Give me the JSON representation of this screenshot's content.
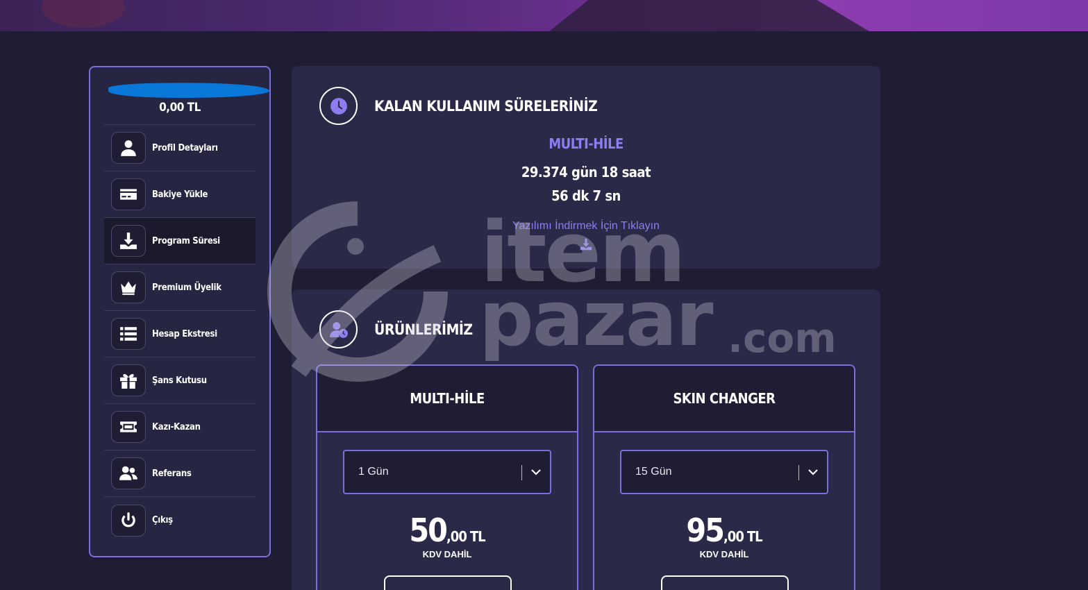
{
  "sidebar": {
    "balance": "0,00 TL",
    "items": [
      {
        "label": "Profil Detayları",
        "icon": "user-icon"
      },
      {
        "label": "Bakiye Yükle",
        "icon": "credit-card-icon"
      },
      {
        "label": "Program Süresi",
        "icon": "download-icon",
        "active": true
      },
      {
        "label": "Premium Üyelik",
        "icon": "crown-icon"
      },
      {
        "label": "Hesap Ekstresi",
        "icon": "list-icon"
      },
      {
        "label": "Şans Kutusu",
        "icon": "gift-icon"
      },
      {
        "label": "Kazı-Kazan",
        "icon": "ticket-icon"
      },
      {
        "label": "Referans",
        "icon": "users-icon"
      },
      {
        "label": "Çıkış",
        "icon": "power-icon"
      }
    ]
  },
  "usage_card": {
    "title": "KALAN KULLANIM SÜRELERİNİZ",
    "product_name": "MULTI-HİLE",
    "time_line1": "29.374 gün 18 saat",
    "time_line2": "56 dk 7 sn",
    "download_text": "Yazılımı İndirmek İçin Tıklayın"
  },
  "products_card": {
    "title": "ÜRÜNLERİMİZ",
    "products": [
      {
        "name": "MULTI-HİLE",
        "selected_duration": "1 Gün",
        "price_int": "50",
        "price_dec": ",00",
        "currency": "TL",
        "tax_note": "KDV DAHİL"
      },
      {
        "name": "SKIN CHANGER",
        "selected_duration": "15 Gün",
        "price_int": "95",
        "price_dec": ",00",
        "currency": "TL",
        "tax_note": "KDV DAHİL"
      }
    ]
  },
  "watermark": {
    "line1": "item",
    "line2": "pazar",
    "line3": ".com"
  },
  "colors": {
    "accent": "#7d6ee0",
    "accent_text": "#8e7cf3",
    "background": "#1e1d33",
    "card": "#2a2947"
  }
}
